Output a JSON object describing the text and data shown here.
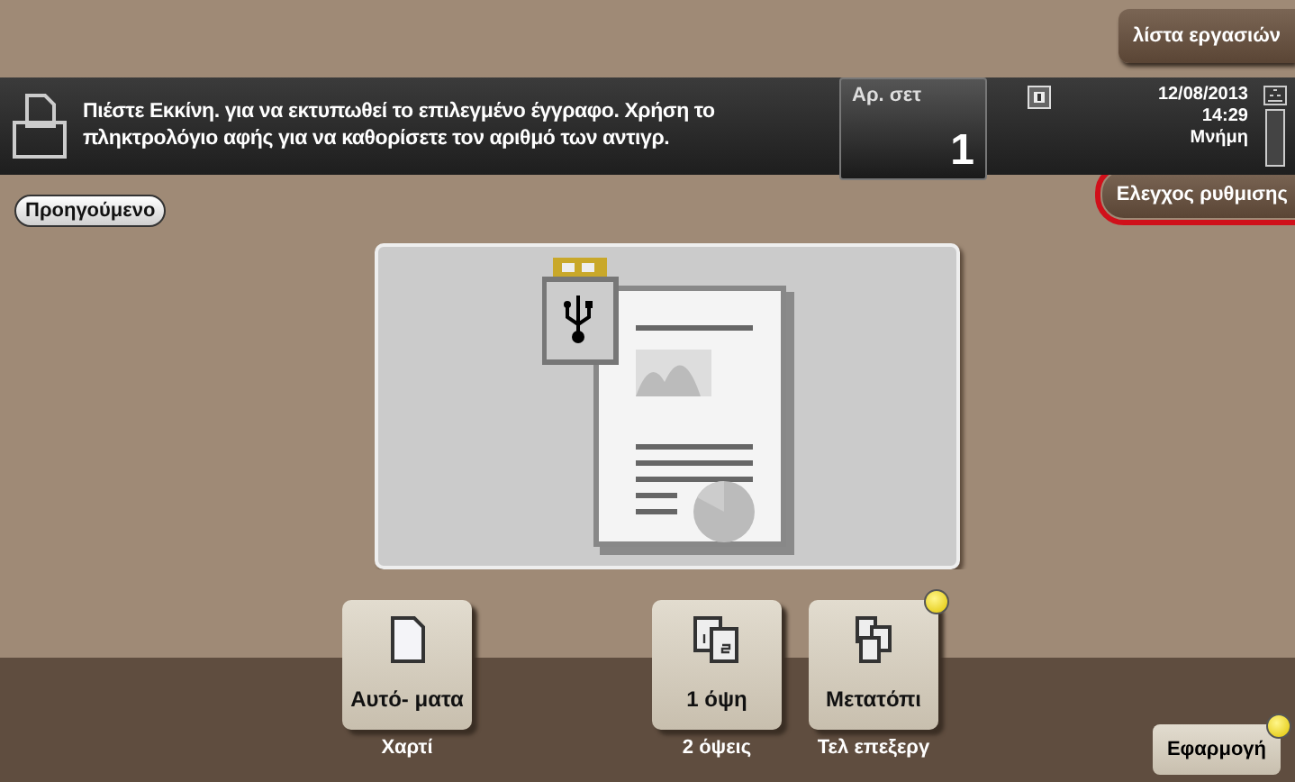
{
  "header": {
    "job_list_button": "λίστα εργασιών"
  },
  "message": {
    "text": "Πιέστε Εκκίνη.  για να εκτυπωθεί το επιλεγμένο έγγραφο. Χρήση το πληκτρολόγιο αφής για να καθορίσετε τον αριθμό των αντιγρ."
  },
  "copies": {
    "label": "Αρ. σετ",
    "value": "1"
  },
  "status": {
    "date": "12/08/2013",
    "time": "14:29",
    "memory_label": "Μνήμη"
  },
  "back_button": "Προηγούμενο",
  "check_settings_button": {
    "label": "Ελεγχος ρυθμισης",
    "highlighted": true
  },
  "tiles": [
    {
      "kind": "paper",
      "label": "Αυτό- ματα",
      "caption": "Χαρτί",
      "indicator": false
    },
    {
      "kind": "duplex",
      "label": "1 όψη",
      "caption": "2 όψεις",
      "indicator": false
    },
    {
      "kind": "shift",
      "label": "Μετατόπι",
      "caption": "Τελ επεξεργ",
      "indicator": true
    }
  ],
  "apply_button": {
    "label": "Εφαρμογή",
    "indicator": true
  }
}
